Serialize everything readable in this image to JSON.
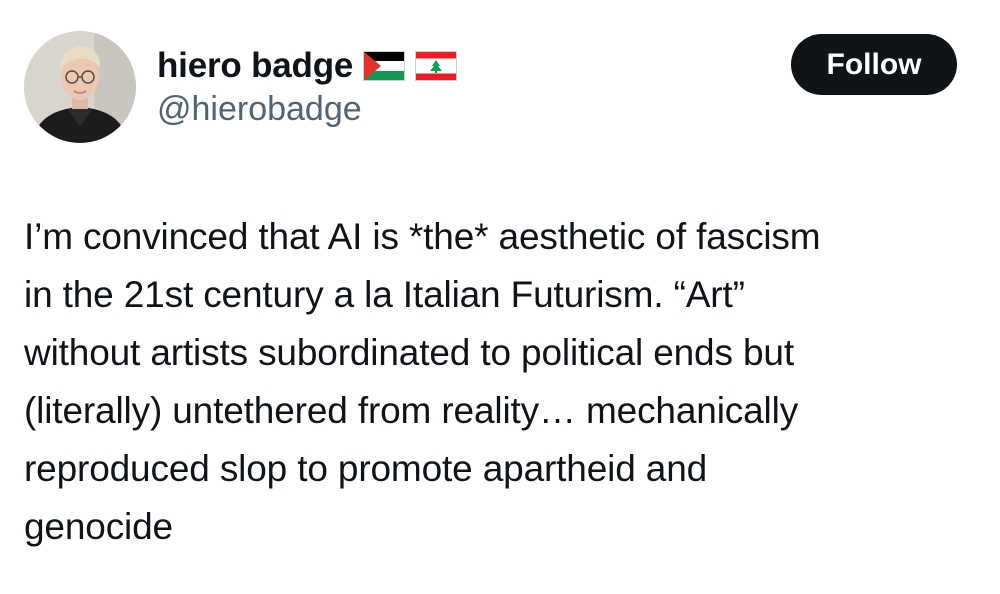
{
  "author": {
    "display_name": "hiero badge",
    "handle": "@hierobadge",
    "flags": [
      "palestine-flag-icon",
      "lebanon-flag-icon"
    ]
  },
  "follow_label": "Follow",
  "tweet": {
    "lines": [
      "I’m convinced that AI is *the* aesthetic of fascism",
      "in the 21st century a la Italian Futurism. “Art”",
      "without artists subordinated to political ends but",
      "(literally) untethered from reality… mechanically",
      "reproduced slop to promote apartheid and",
      "genocide"
    ]
  },
  "colors": {
    "text": "#0f1419",
    "secondary_text": "#536471",
    "button_bg": "#0f1419",
    "button_text": "#ffffff",
    "background": "#ffffff"
  }
}
